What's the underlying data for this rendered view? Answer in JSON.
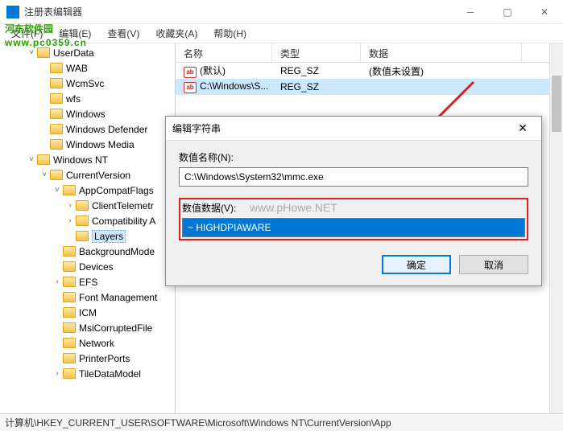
{
  "window": {
    "title": "注册表编辑器"
  },
  "menu": {
    "file": "文件(F)",
    "edit": "编辑(E)",
    "view": "查看(V)",
    "favorites": "收藏夹(A)",
    "help": "帮助(H)"
  },
  "tree": {
    "items": [
      {
        "indent": 2,
        "exp": "˅",
        "label": "UserData"
      },
      {
        "indent": 3,
        "exp": "",
        "label": "WAB"
      },
      {
        "indent": 3,
        "exp": "",
        "label": "WcmSvc"
      },
      {
        "indent": 3,
        "exp": "",
        "label": "wfs"
      },
      {
        "indent": 3,
        "exp": "",
        "label": "Windows"
      },
      {
        "indent": 3,
        "exp": "",
        "label": "Windows Defender"
      },
      {
        "indent": 3,
        "exp": "",
        "label": "Windows Media"
      },
      {
        "indent": 2,
        "exp": "˅",
        "label": "Windows NT"
      },
      {
        "indent": 3,
        "exp": "˅",
        "label": "CurrentVersion"
      },
      {
        "indent": 4,
        "exp": "˅",
        "label": "AppCompatFlags"
      },
      {
        "indent": 5,
        "exp": "›",
        "label": "ClientTelemetr"
      },
      {
        "indent": 5,
        "exp": "›",
        "label": "Compatibility A"
      },
      {
        "indent": 5,
        "exp": "",
        "label": "Layers",
        "selected": true
      },
      {
        "indent": 4,
        "exp": "",
        "label": "BackgroundMode"
      },
      {
        "indent": 4,
        "exp": "",
        "label": "Devices"
      },
      {
        "indent": 4,
        "exp": "›",
        "label": "EFS"
      },
      {
        "indent": 4,
        "exp": "",
        "label": "Font Management"
      },
      {
        "indent": 4,
        "exp": "",
        "label": "ICM"
      },
      {
        "indent": 4,
        "exp": "",
        "label": "MsiCorruptedFile"
      },
      {
        "indent": 4,
        "exp": "",
        "label": "Network"
      },
      {
        "indent": 4,
        "exp": "",
        "label": "PrinterPorts"
      },
      {
        "indent": 4,
        "exp": "›",
        "label": "TileDataModel"
      }
    ]
  },
  "list": {
    "columns": {
      "name": "名称",
      "type": "类型",
      "data": "数据"
    },
    "colw": {
      "name": 120,
      "type": 110,
      "data": 200
    },
    "rows": [
      {
        "name": "(默认)",
        "type": "REG_SZ",
        "data": "(数值未设置)",
        "selected": false
      },
      {
        "name": "C:\\Windows\\S...",
        "type": "REG_SZ",
        "data": "",
        "selected": true
      }
    ]
  },
  "dialog": {
    "title": "编辑字符串",
    "name_label": "数值名称(N):",
    "name_value": "C:\\Windows\\System32\\mmc.exe",
    "data_label": "数值数据(V):",
    "data_value": "~ HIGHDPIAWARE",
    "ok": "确定",
    "cancel": "取消"
  },
  "statusbar": {
    "path": "计算机\\HKEY_CURRENT_USER\\SOFTWARE\\Microsoft\\Windows NT\\CurrentVersion\\App"
  },
  "watermark": {
    "line1": "河东软件园",
    "line2": "www.pc0359.cn"
  },
  "watermark2": "www.pHowe.NET"
}
